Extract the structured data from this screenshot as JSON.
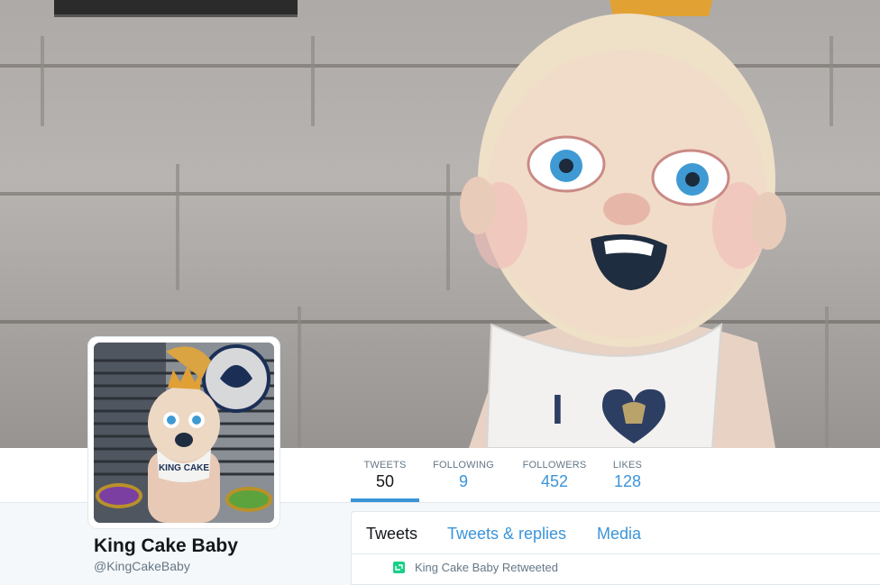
{
  "profile": {
    "name": "King Cake Baby",
    "handle": "@KingCakeBaby"
  },
  "stats": [
    {
      "label": "TWEETS",
      "value": "50"
    },
    {
      "label": "FOLLOWING",
      "value": "9"
    },
    {
      "label": "FOLLOWERS",
      "value": "452"
    },
    {
      "label": "LIKES",
      "value": "128"
    }
  ],
  "timeline": {
    "tabs": [
      {
        "label": "Tweets"
      },
      {
        "label": "Tweets & replies"
      },
      {
        "label": "Media"
      }
    ],
    "retweet_notice": "King Cake Baby Retweeted"
  },
  "colors": {
    "link": "#3b94d9",
    "retweet": "#19cf86",
    "text": "#14171a",
    "muted": "#657786"
  },
  "icons": {
    "retweet": "retweet-icon"
  }
}
